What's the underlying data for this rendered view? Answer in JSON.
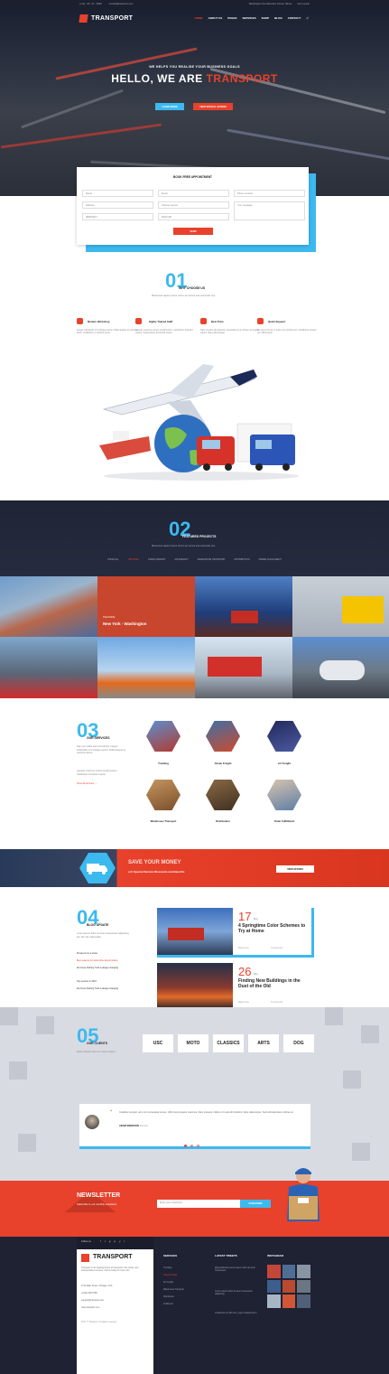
{
  "topbar": {
    "phone": "(+12) - 00 - 01 - 9999",
    "email": "contact@transport.com",
    "address": "Washington Ave West Elm Corner, Illinois",
    "call": "Get a quote"
  },
  "nav": {
    "logo": "TRANSPORT",
    "items": [
      "HOME",
      "ABOUT US",
      "PAGES",
      "SERVICES",
      "SHOP",
      "BLOG",
      "CONTACT"
    ]
  },
  "hero": {
    "subtitle": "WE HELPS YOU REALISE YOUR BUSINESS GOALS",
    "title_prefix": "HELLO, WE ARE ",
    "title_accent": "TRANSPORT",
    "btn_learn": "LEARN MORE",
    "btn_offers": "VIEW SPECIAL OFFERS"
  },
  "form": {
    "title": "BOOK FREE APPOINTMENT",
    "name": "Name",
    "email": "Email",
    "phone": "Phone number",
    "address": "Address",
    "service": "Choose service",
    "message": "Your message",
    "date": "08/05/2017",
    "time": "09:00 AM",
    "send": "SEND"
  },
  "why": {
    "num": "01",
    "title": "WHY CHOOSE US",
    "desc": "Maecenas sapien metus rutrum ac cursus erat venenatis non.",
    "features": [
      {
        "title": "Modern Workshop",
        "desc": "Integer sollicitudin orci tristique auctor. Pellentesque at maximus lacus. Vestibulum et ultricies purus."
      },
      {
        "title": "Highly Trained Staff",
        "desc": "Aenean maximus cursus condimentum. Vestibulum tincidunt mauris. Suspendisse at lobortis neque."
      },
      {
        "title": "Best Price",
        "desc": "Nam sit amet elit pharetra, venenatis leo at. Donec ac feugiat sapien vitae pellentesque."
      },
      {
        "title": "Quick Support",
        "desc": "Se ipsum hic aut in quae nos omnibus erit. Vestibulum tempor nec ullamcorper."
      }
    ]
  },
  "projects": {
    "num": "02",
    "title": "FEATURED PROJECTS",
    "desc": "Maecenas sapien metus rutrum ac cursus erat venenatis non.",
    "filters": [
      "SHOW ALL",
      "TRUCKING",
      "OCEAN FREIGHT",
      "AIR FREIGHT",
      "WAREHOUSE TRANSPORT",
      "DISTRIBUTION",
      "ORDER FULFILLMENT"
    ],
    "caption_tag": "TRUCKING",
    "caption_title": "New York - Washington"
  },
  "services": {
    "num": "03",
    "title": "OUR SERVICES",
    "desc1": "Nam nec tellus sed orci lobortis. Integer sollicitudin orci tristique auctor. Pellentesque at maximus lacus.",
    "desc2": "Aenean maximus cursus condimentum. Vestibulum tincidunt mauris.",
    "link": "View all services →",
    "items": [
      "Trucking",
      "Ocean Freight",
      "Air Freight",
      "Warehouse Transport",
      "Distribution",
      "Order Fulfillment"
    ]
  },
  "banner": {
    "title": "SAVE YOUR MONEY",
    "sub_prefix": "with ",
    "sub_bold": "Special Service Discounts and Benefits",
    "btn": "VIEW OFFERS"
  },
  "blog": {
    "num": "04",
    "title": "BLOG UPDATE",
    "desc": "Lorem ipsum dolor sit amet consectetur adipiscing elit. Dui nisi malesuada.",
    "list": [
      "Prospects for a winter",
      "Best seasons for Automotive Export Advice",
      "We Know Nothing Truth is always changing.",
      "Top services in 2016",
      "We Know Nothing Truth is always changing."
    ],
    "posts": [
      {
        "day": "17",
        "month": "May",
        "title": "4 Springtime Color Schemes to Try at Home",
        "meta": "Read more",
        "comments": "3 comments"
      },
      {
        "day": "26",
        "month": "May",
        "title": "Finding New Buildings in the Dust of the Old",
        "meta": "Read more",
        "comments": "5 comments"
      }
    ]
  },
  "clients": {
    "num": "05",
    "title": "OUR CLIENTS",
    "desc": "Etiam aliquam nisl nec cursus sapien.",
    "logos": [
      "USC",
      "MOTO",
      "CLASSICS",
      "ARTS",
      "DOG"
    ],
    "quote": "Curabitur semper, arcu non consequat cursus, nibh risus posuere maximus. Nam posuere. Nulla ut mi sed elit tincidunt. Nam ullamcorper. Sed vehicula lorem ultrices at.",
    "author": "ADAM SMOKSON",
    "author_role": "Director"
  },
  "newsletter": {
    "title": "NEWSLETTER",
    "sub": "Subscribe to our monthly newsletter",
    "placeholder": "Enter your email here",
    "btn": "SUBSCRIBE"
  },
  "footer": {
    "follow": "Follow us",
    "logo": "TRANSPORT",
    "about": "Transport is the leading theme of transports. We create new transportation services. Call us today for more info.",
    "contact": [
      "1711 Main Street, Chicago, USA",
      "+(012) 345 6789",
      "support@transport.com",
      "www.transport.com"
    ],
    "copyright": "2017 © Transport. All rights reserved.",
    "col_services": "SERVICES",
    "services": [
      "Trucking",
      "Ocean Freight",
      "Air Freight",
      "Warehouse Transport",
      "Distribution",
      "Fulfillment"
    ],
    "col_tweets": "LATEST TWEETS",
    "tweets": [
      "@QuickStudio Lorem ipsum dolor sit amet consectetur.",
      "Lorem ipsum dolor sit amet consectetur adipiscing.",
      "Vestibulum at nibh sem, eget volutpat lorem."
    ],
    "col_instagram": "INSTAGRAM"
  },
  "colors": {
    "accent": "#e8412c",
    "blue": "#3cb9ef",
    "dark": "#1f2233"
  }
}
